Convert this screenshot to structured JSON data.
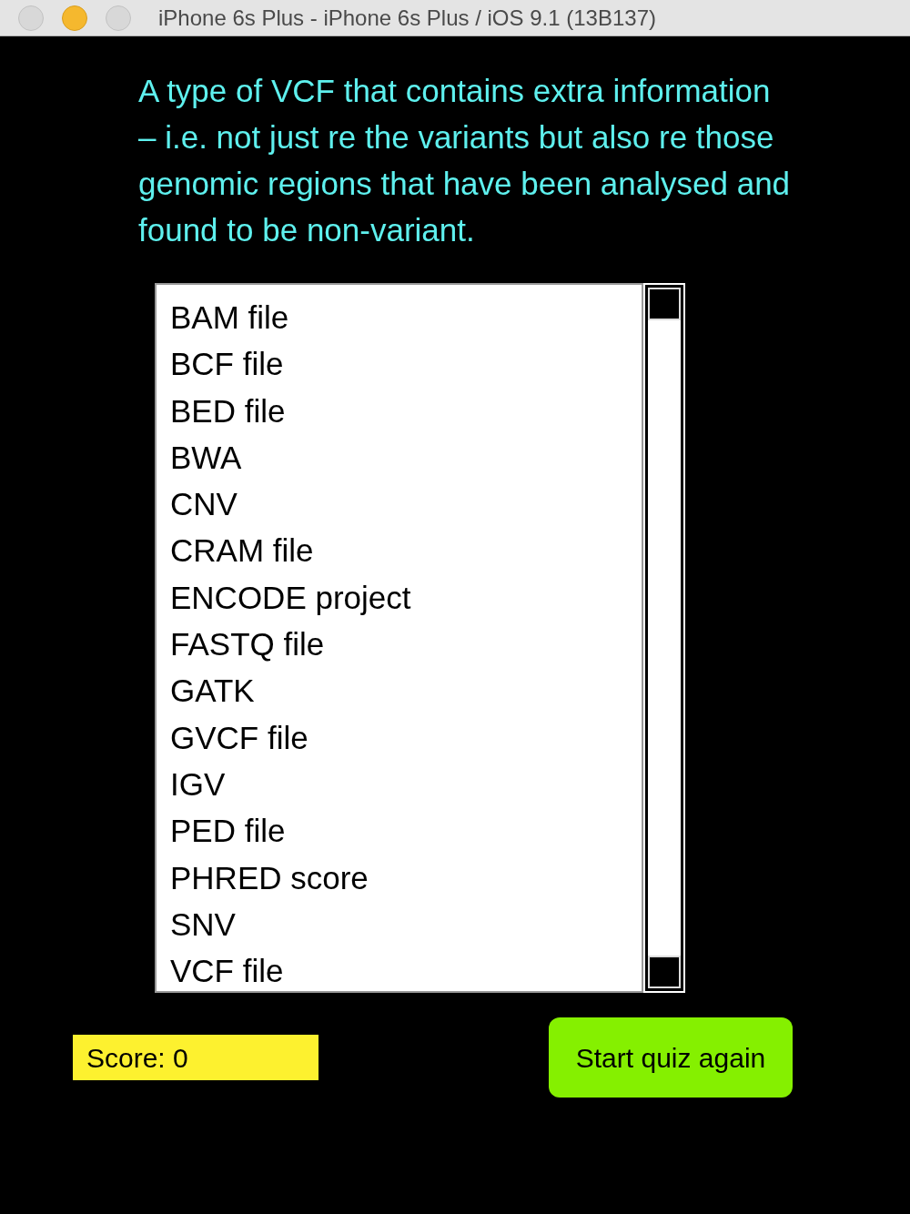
{
  "window": {
    "title": "iPhone 6s Plus - iPhone 6s Plus / iOS 9.1 (13B137)"
  },
  "question": "A type of VCF that contains extra information – i.e. not just re the variants but also re those genomic regions that have been analysed and found to be non-variant.",
  "answers": [
    "BAM file",
    "BCF file",
    "BED file",
    "BWA",
    "CNV",
    "CRAM file",
    "ENCODE project",
    "FASTQ file",
    "GATK",
    "GVCF file",
    "IGV",
    "PED file",
    "PHRED score",
    "SNV",
    "VCF file"
  ],
  "score": "Score: 0",
  "restart_button": "Start quiz again"
}
